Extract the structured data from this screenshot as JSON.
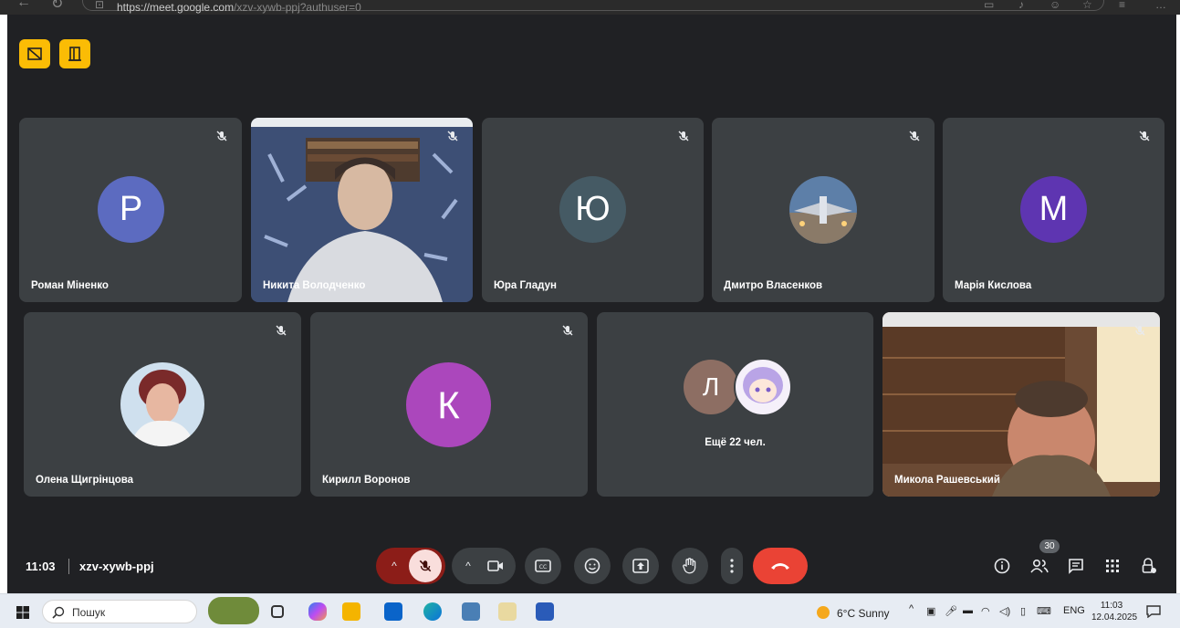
{
  "browser": {
    "url_host": "https://meet.google.com",
    "url_path": "/xzv-xywb-ppj?authuser=0"
  },
  "meeting": {
    "time": "11:03",
    "code": "xzv-xywb-ppj",
    "participant_count": "30",
    "more_label": "Ещё 22 чел."
  },
  "tiles": [
    {
      "name": "Роман Міненко",
      "initial": "Р",
      "color": "#5c6bc0"
    },
    {
      "name": "Никита Володченко"
    },
    {
      "name": "Юра Гладун",
      "initial": "Ю",
      "color": "#455a64"
    },
    {
      "name": "Дмитро Власенков"
    },
    {
      "name": "Марія Кислова",
      "initial": "М",
      "color": "#5e35b1"
    },
    {
      "name": "Олена Щигрінцова"
    },
    {
      "name": "Кирилл Воронов",
      "initial": "К",
      "color": "#ab47bc"
    },
    {
      "name": "",
      "initial": "Л",
      "color": "#8d6e63"
    },
    {
      "name": "Микола Рашевський"
    }
  ],
  "taskbar": {
    "search_placeholder": "Пошук",
    "weather": "6°C  Sunny",
    "lang": "ENG",
    "time": "11:03",
    "date": "12.04.2025"
  },
  "icons": [
    "back-icon",
    "reload-icon",
    "tab-icon",
    "mic-off-icon",
    "camera-icon",
    "captions-icon",
    "emoji-icon",
    "present-icon",
    "raise-hand-icon",
    "more-options-icon",
    "end-call-icon",
    "info-icon",
    "people-icon",
    "chat-icon",
    "activities-icon",
    "host-controls-icon"
  ]
}
